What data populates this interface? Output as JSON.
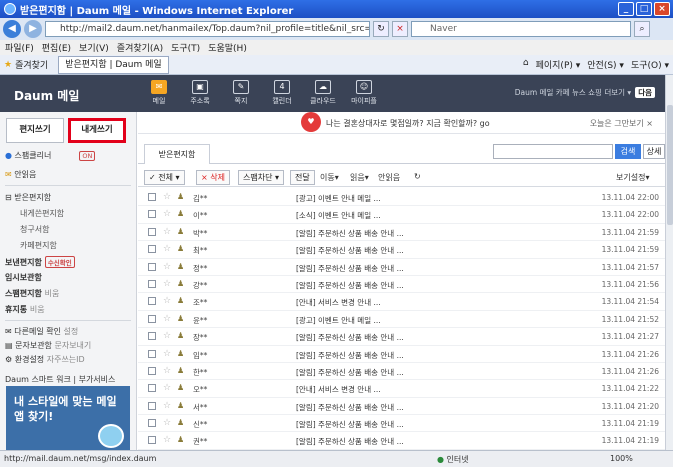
{
  "window": {
    "title": "받은편지함 | Daum 메일 - Windows Internet Explorer"
  },
  "address": {
    "url": "http://mail2.daum.net/hanmailex/Top.daum?nil_profile=title&nil_src=hanmail",
    "search_placeholder": "Naver"
  },
  "menu": [
    "파일(F)",
    "편집(E)",
    "보기(V)",
    "즐겨찾기(A)",
    "도구(T)",
    "도움말(H)"
  ],
  "favorites": {
    "label": "즐겨찾기",
    "tab": "받은편지함 | Daum 메일",
    "right": [
      "페이지(P) ▾",
      "안전(S) ▾",
      "도구(O) ▾"
    ]
  },
  "daum": {
    "logo": "Daum 메일",
    "nav": [
      {
        "label": "메일",
        "icon": "mail-icon"
      },
      {
        "label": "주소록",
        "icon": "addressbook-icon"
      },
      {
        "label": "쪽지",
        "icon": "note-icon"
      },
      {
        "label": "캘린더",
        "icon": "calendar-icon"
      },
      {
        "label": "클라우드",
        "icon": "cloud-icon"
      },
      {
        "label": "마이피플",
        "icon": "mypeople-icon"
      }
    ],
    "right_links": "Daum 메일 카페 뉴스 쇼핑 더보기 ▾",
    "user": "다음"
  },
  "sidebar": {
    "write": "편지쓰기",
    "write_self": "내게쓰기",
    "spam": "스팸클리너",
    "spam_badge": "ON",
    "inbox_all": "받은편지함",
    "folders": [
      "내게쓴편지함",
      "청구서함",
      "카페편지함"
    ],
    "sent": "보낸편지함",
    "sent_badge": "수신확인",
    "draft": "임시보관함",
    "spam_box": "스팸편지함",
    "spam_box_action": "비움",
    "trash": "휴지통",
    "trash_action": "비움",
    "other_mail": "다른메일 확인",
    "other_mail_sub": "설정",
    "sms": "문자보관함",
    "sms_sub": "문자보내기",
    "settings": "환경설정",
    "settings_sub": "자주쓰는ID",
    "smart_work": "Daum 스마트 워크 | 부가서비스",
    "ad_text": "내 스타일에 맞는 메일앱 찾기!"
  },
  "main": {
    "banner": "나는 결혼상대자로 몇점일까? 지금 확인할까? go",
    "banner_right": "오늘은 그만보기 ×",
    "tab": "받은편지함",
    "search_btn": "검색",
    "detail_btn": "상세",
    "toolbar": {
      "all": "✓ 전체 ▾",
      "delete": "× 삭제",
      "spam": "스팸차단 ▾",
      "reply": "전달",
      "move": "이동▾",
      "read": "읽음▾",
      "unread": "안읽음",
      "view": "보기설정▾"
    },
    "rows": [
      {
        "sender": "김**",
        "subject": "[광고] 이벤트 안내 메일 ...",
        "date": "13.11.04 22:00"
      },
      {
        "sender": "이**",
        "subject": "[소식] 이벤트 안내 메일 ...",
        "date": "13.11.04 22:00"
      },
      {
        "sender": "박**",
        "subject": "[알림] 주문하신 상품 배송 안내 ...",
        "date": "13.11.04 21:59"
      },
      {
        "sender": "최**",
        "subject": "[알림] 주문하신 상품 배송 안내 ...",
        "date": "13.11.04 21:59"
      },
      {
        "sender": "정**",
        "subject": "[알림] 주문하신 상품 배송 안내 ...",
        "date": "13.11.04 21:57"
      },
      {
        "sender": "강**",
        "subject": "[알림] 주문하신 상품 배송 안내 ...",
        "date": "13.11.04 21:56"
      },
      {
        "sender": "조**",
        "subject": "[안내] 서비스 변경 안내 ...",
        "date": "13.11.04 21:54"
      },
      {
        "sender": "윤**",
        "subject": "[광고] 이벤트 안내 메일 ...",
        "date": "13.11.04 21:52"
      },
      {
        "sender": "장**",
        "subject": "[알림] 주문하신 상품 배송 안내 ...",
        "date": "13.11.04 21:27"
      },
      {
        "sender": "임**",
        "subject": "[알림] 주문하신 상품 배송 안내 ...",
        "date": "13.11.04 21:26"
      },
      {
        "sender": "한**",
        "subject": "[알림] 주문하신 상품 배송 안내 ...",
        "date": "13.11.04 21:26"
      },
      {
        "sender": "오**",
        "subject": "[안내] 서비스 변경 안내 ...",
        "date": "13.11.04 21:22"
      },
      {
        "sender": "서**",
        "subject": "[알림] 주문하신 상품 배송 안내 ...",
        "date": "13.11.04 21:20"
      },
      {
        "sender": "신**",
        "subject": "[알림] 주문하신 상품 배송 안내 ...",
        "date": "13.11.04 21:19"
      },
      {
        "sender": "권**",
        "subject": "[알림] 주문하신 상품 배송 안내 ...",
        "date": "13.11.04 21:19"
      }
    ]
  },
  "status": {
    "url": "http://mail.daum.net/msg/index.daum",
    "zone": "인터넷",
    "zoom": "100%"
  }
}
